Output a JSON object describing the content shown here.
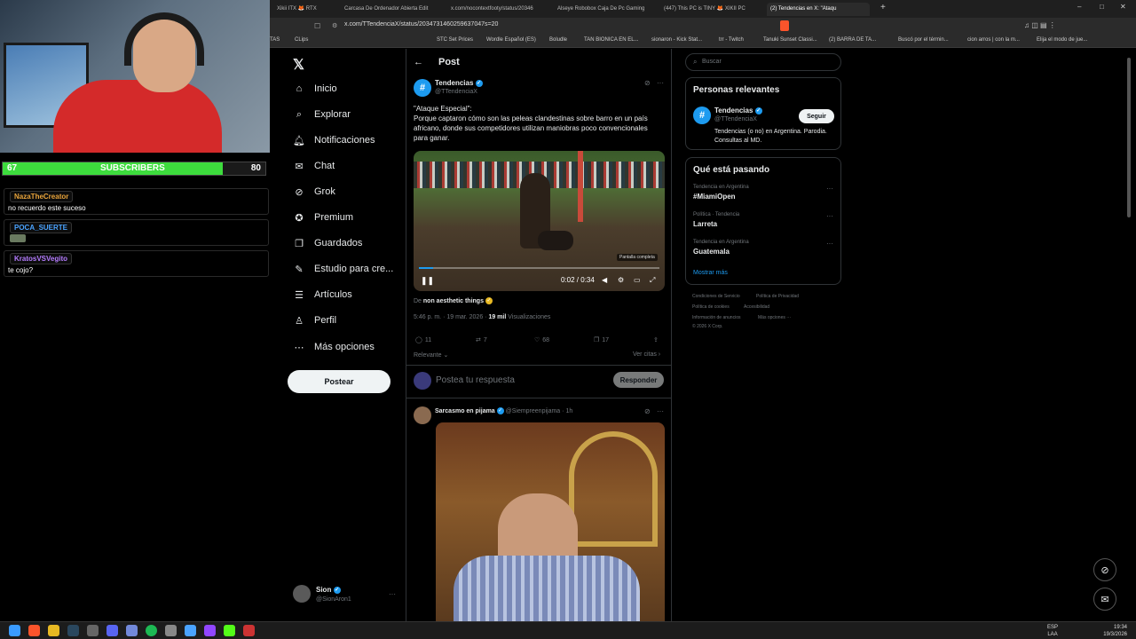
{
  "stream": {
    "subs_current": "67",
    "subs_label": "SUBSCRIBERS",
    "subs_goal": "80",
    "subs_progress": 0.8375,
    "chat": [
      {
        "user": "NazaTheCreator",
        "user_color": "#e8a33a",
        "message": "no recuerdo este suceso"
      },
      {
        "user": "POCA_SUERTE",
        "user_color": "#4aa3ff",
        "message": ""
      },
      {
        "user": "KratosVSVegito",
        "user_color": "#b57cff",
        "message": "te cojo?"
      }
    ]
  },
  "browser": {
    "tabs": [
      "Xikii ITX 🦊 RTX",
      "Carcasa De Ordenador Abierta Edit",
      "x.com/nocontextfooty/status/20346",
      "Alseye Robobox Caja De Pc Gaming",
      "(447) This PC is TINY 🦊 XIKII PC",
      "(2) Tendencias en X: \"Ataqu"
    ],
    "url": "x.com/TTendenciaX/status/2034731460259637047s=20",
    "bookmarks": [
      "TAS",
      "CLips",
      "STC Set Prices",
      "Wordle Español (ES)",
      "Boludle",
      "TAN BIONICA EN EL...",
      "sionaron - Kick Stat...",
      "trr - Twitch",
      "Tanuki Sunset Classi...",
      "(2) BARRA DE TA...",
      "Buscó por el términ...",
      "cion arros | con la m...",
      "Elija el modo de jue..."
    ]
  },
  "nav": {
    "items": [
      {
        "label": "Inicio",
        "icon": "home-icon"
      },
      {
        "label": "Explorar",
        "icon": "search-icon"
      },
      {
        "label": "Notificaciones",
        "icon": "bell-icon"
      },
      {
        "label": "Chat",
        "icon": "chat-icon"
      },
      {
        "label": "Grok",
        "icon": "grok-icon"
      },
      {
        "label": "Premium",
        "icon": "premium-icon"
      },
      {
        "label": "Guardados",
        "icon": "bookmark-icon"
      },
      {
        "label": "Estudio para cre...",
        "icon": "studio-icon"
      },
      {
        "label": "Artículos",
        "icon": "articles-icon"
      },
      {
        "label": "Perfil",
        "icon": "profile-icon"
      },
      {
        "label": "Más opciones",
        "icon": "more-icon"
      }
    ],
    "post_button": "Postear",
    "account_name": "Sion",
    "account_handle": "@SionAron1"
  },
  "post": {
    "header": "Post",
    "author_name": "Tendencias",
    "author_handle": "@TTendenciaX",
    "text_title": "\"Ataque Especial\":",
    "text_body": "Porque captaron cómo son las peleas clandestinas sobre barro en un país africano, donde sus competidores utilizan maniobras poco convencionales para ganar.",
    "video_time": "0:02 / 0:34",
    "fullscreen_tooltip": "Pantalla completa",
    "source_prefix": "De",
    "source_name": "non aesthetic things",
    "timestamp": "5:46 p. m. · 19 mar. 2026 ·",
    "views": "19 mil",
    "views_label": "Visualizaciones",
    "replies": "11",
    "reposts": "7",
    "likes": "68",
    "bookmarks": "17",
    "sort_label": "Relevante",
    "quotes_link": "Ver citas",
    "reply_placeholder": "Postea tu respuesta",
    "reply_button": "Responder"
  },
  "reply": {
    "author_name": "Sarcasmo en pijama",
    "author_handle": "@Siempreenpijama",
    "time": "1h"
  },
  "sidebar": {
    "search_placeholder": "Buscar",
    "relevant_title": "Personas relevantes",
    "relevant_name": "Tendencias",
    "relevant_handle": "@TTendenciaX",
    "relevant_follow": "Seguir",
    "relevant_bio": "Tendencias (o no) en Argentina. Parodia. Consultas al MD.",
    "trends_title": "Qué está pasando",
    "trends": [
      {
        "category": "Tendencia en Argentina",
        "name": "#MiamiOpen"
      },
      {
        "category": "Política · Tendencia",
        "name": "Larreta"
      },
      {
        "category": "Tendencia en Argentina",
        "name": "Guatemala"
      }
    ],
    "show_more": "Mostrar más",
    "footer": [
      "Condiciones de Servicio",
      "Política de Privacidad",
      "Política de cookies",
      "Accesibilidad",
      "Información de anuncios",
      "Más opciones ···",
      "© 2026 X Corp."
    ]
  },
  "taskbar": {
    "lang": "ESP",
    "lang_sub": "LAA",
    "time": "19:34",
    "date": "19/3/2026"
  }
}
